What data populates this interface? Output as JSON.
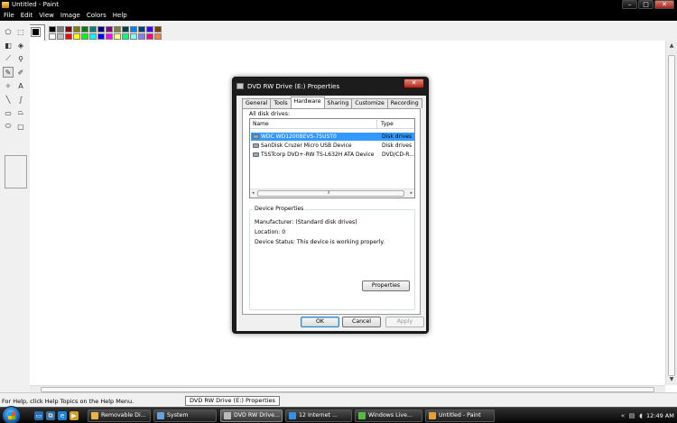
{
  "window": {
    "title": "Untitled - Paint",
    "buttons": {
      "minimize": "–",
      "maximize": "□",
      "close": "✕"
    }
  },
  "menu": [
    "File",
    "Edit",
    "View",
    "Image",
    "Colors",
    "Help"
  ],
  "palette": {
    "colors": [
      "#000000",
      "#808080",
      "#800000",
      "#808000",
      "#008000",
      "#008080",
      "#000080",
      "#800080",
      "#808040",
      "#004040",
      "#0080ff",
      "#004080",
      "#4000ff",
      "#804000",
      "#ffffff",
      "#c0c0c0",
      "#ff0000",
      "#ffff00",
      "#00ff00",
      "#00ffff",
      "#0000ff",
      "#ff00ff",
      "#ffff80",
      "#00ff80",
      "#80ffff",
      "#8080ff",
      "#ff0080",
      "#ff8040"
    ]
  },
  "tools": [
    {
      "name": "free-select-icon",
      "glyph": "⬠"
    },
    {
      "name": "select-icon",
      "glyph": "⬚"
    },
    {
      "name": "eraser-icon",
      "glyph": "◧"
    },
    {
      "name": "fill-icon",
      "glyph": "◈"
    },
    {
      "name": "color-picker-icon",
      "glyph": "⟋"
    },
    {
      "name": "magnifier-icon",
      "glyph": "⚲"
    },
    {
      "name": "pencil-icon",
      "glyph": "✎"
    },
    {
      "name": "brush-icon",
      "glyph": "✐"
    },
    {
      "name": "airbrush-icon",
      "glyph": "✧"
    },
    {
      "name": "text-icon",
      "glyph": "A"
    },
    {
      "name": "line-icon",
      "glyph": "╲"
    },
    {
      "name": "curve-icon",
      "glyph": "∫"
    },
    {
      "name": "rectangle-icon",
      "glyph": "▭"
    },
    {
      "name": "polygon-icon",
      "glyph": "⏢"
    },
    {
      "name": "ellipse-icon",
      "glyph": "⬭"
    },
    {
      "name": "rounded-rect-icon",
      "glyph": "▢"
    }
  ],
  "statusbar": {
    "text": "For Help, click Help Topics on the Help Menu.",
    "tooltip": "DVD RW Drive (E:) Properties"
  },
  "dialog": {
    "title": "DVD RW Drive (E:) Properties",
    "close": "✕",
    "tabs": [
      "General",
      "Tools",
      "Hardware",
      "Sharing",
      "Customize",
      "Recording"
    ],
    "active_tab": "Hardware",
    "all_disk_drives_label": "All disk drives:",
    "columns": {
      "name": "Name",
      "type": "Type"
    },
    "rows": [
      {
        "name": "WDC WD1200BEVS-75UST0",
        "type": "Disk drives"
      },
      {
        "name": "SanDisk Cruzer Micro USB Device",
        "type": "Disk drives"
      },
      {
        "name": "TSSTcorp DVD+-RW TS-L632H ATA Device",
        "type": "DVD/CD-R..."
      }
    ],
    "scroll": {
      "left": "◂",
      "right": "▸",
      "grip": "⦀"
    },
    "device_properties": {
      "title": "Device Properties",
      "manufacturer": "Manufacturer: (Standard disk drives)",
      "location": "Location: 0",
      "status": "Device Status: This device is working properly."
    },
    "buttons": {
      "properties": "Properties",
      "ok": "OK",
      "cancel": "Cancel",
      "apply": "Apply"
    }
  },
  "taskbar": {
    "items": [
      {
        "label": "Removable Di...",
        "color": "#e8b44a"
      },
      {
        "label": "System",
        "color": "#6aa0d8"
      },
      {
        "label": "DVD RW Drive...",
        "color": "#bbbbbb"
      },
      {
        "label": "12 Internet ...",
        "color": "#3a8de0"
      },
      {
        "label": "Windows Live...",
        "color": "#58b848"
      },
      {
        "label": "Untitled - Paint",
        "color": "#e0a040"
      }
    ],
    "active_item": "DVD RW Drive...",
    "clock": "12:49 AM"
  }
}
